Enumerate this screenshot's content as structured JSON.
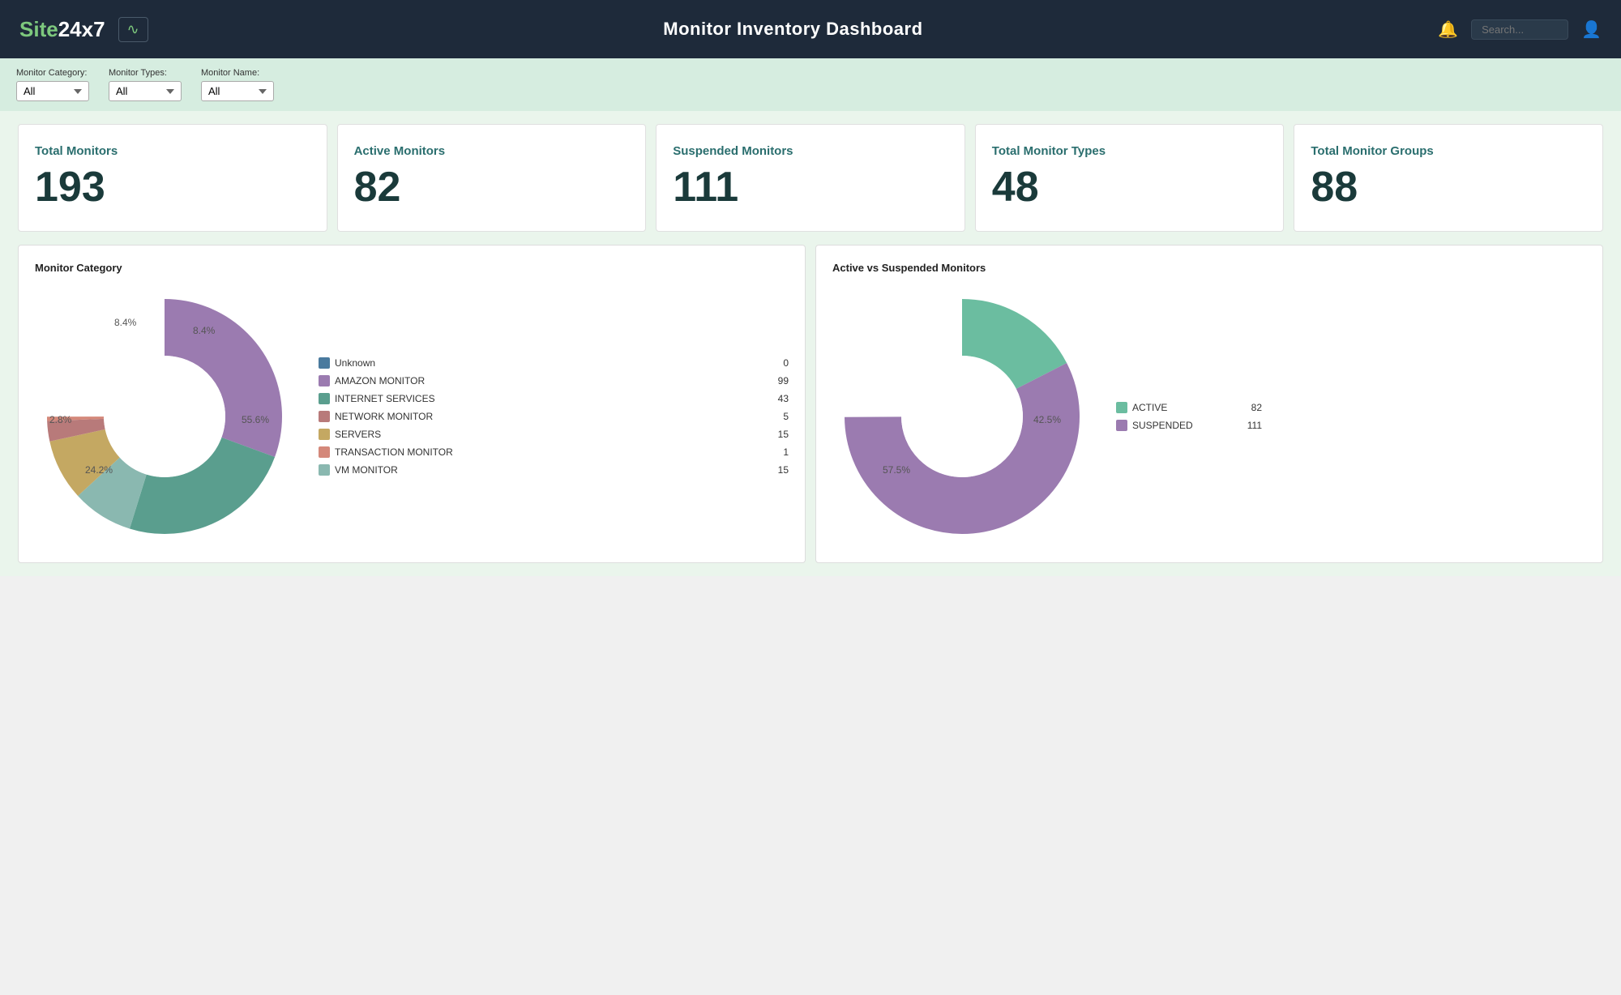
{
  "header": {
    "logo_site": "Site",
    "logo_rest": "24x7",
    "title": "Monitor Inventory Dashboard",
    "search_placeholder": "Search..."
  },
  "filters": {
    "category_label": "Monitor Category:",
    "category_value": "All",
    "types_label": "Monitor Types:",
    "types_value": "All",
    "name_label": "Monitor Name:",
    "name_value": "All"
  },
  "stats": [
    {
      "label": "Total Monitors",
      "value": "193"
    },
    {
      "label": "Active Monitors",
      "value": "82"
    },
    {
      "label": "Suspended Monitors",
      "value": "111"
    },
    {
      "label": "Total Monitor Types",
      "value": "48"
    },
    {
      "label": "Total Monitor Groups",
      "value": "88"
    }
  ],
  "chart_category": {
    "title": "Monitor Category",
    "segments": [
      {
        "label": "AMAZON MONITOR",
        "value": 99,
        "percent": 55.6,
        "color": "#9b7bb0",
        "start_angle": 0
      },
      {
        "label": "VM MONITOR",
        "value": 15,
        "percent": 8.4,
        "color": "#8ab8b0",
        "start_angle": 200
      },
      {
        "label": "SERVERS",
        "value": 15,
        "percent": 8.4,
        "color": "#c4a862",
        "start_angle": 230
      },
      {
        "label": "TRANSACTION MONITOR",
        "value": 1,
        "percent": 0.6,
        "color": "#d4887a",
        "start_angle": 260
      },
      {
        "label": "INTERNET SERVICES",
        "value": 43,
        "percent": 24.2,
        "color": "#5a9e8e",
        "start_angle": 263
      },
      {
        "label": "NETWORK MONITOR",
        "value": 5,
        "percent": 2.8,
        "color": "#b87a7a",
        "start_angle": 350
      },
      {
        "label": "Unknown",
        "value": 0,
        "percent": 0,
        "color": "#4a7a9e",
        "start_angle": 360
      }
    ],
    "donut_labels": [
      {
        "text": "55.6%",
        "x": "72%",
        "y": "55%"
      },
      {
        "text": "24.2%",
        "x": "18%",
        "y": "73%"
      },
      {
        "text": "8.4%",
        "x": "63%",
        "y": "15%"
      },
      {
        "text": "8.4%",
        "x": "33%",
        "y": "14%"
      },
      {
        "text": "2.8%",
        "x": "5%",
        "y": "52%"
      }
    ]
  },
  "chart_active_suspended": {
    "title": "Active vs Suspended Monitors",
    "segments": [
      {
        "label": "ACTIVE",
        "value": 82,
        "percent": 42.5,
        "color": "#6bbda0"
      },
      {
        "label": "SUSPENDED",
        "value": 111,
        "percent": 57.5,
        "color": "#9b7bb0"
      }
    ],
    "donut_labels": [
      {
        "text": "42.5%",
        "x": "72%",
        "y": "55%"
      },
      {
        "text": "57.5%",
        "x": "28%",
        "y": "72%"
      }
    ]
  }
}
